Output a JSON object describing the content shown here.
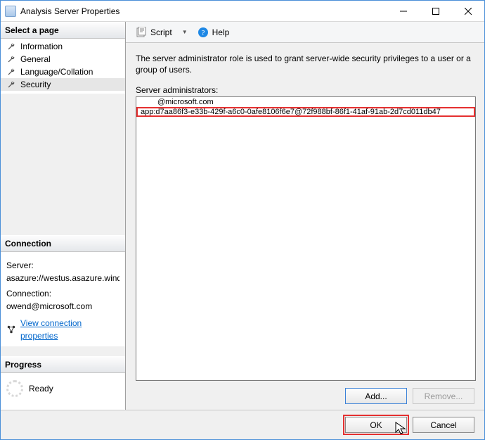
{
  "window": {
    "title": "Analysis Server Properties"
  },
  "left": {
    "select_head": "Select a page",
    "nav": [
      {
        "label": "Information"
      },
      {
        "label": "General"
      },
      {
        "label": "Language/Collation"
      },
      {
        "label": "Security"
      }
    ],
    "connection_head": "Connection",
    "server_label": "Server:",
    "server_value": "asazure://westus.asazure.windows",
    "conn_label": "Connection:",
    "conn_value": "owend@microsoft.com",
    "view_props": "View connection properties",
    "progress_head": "Progress",
    "progress_status": "Ready"
  },
  "toolbar": {
    "script": "Script",
    "help": "Help"
  },
  "main": {
    "intro": "The server administrator role is used to grant server-wide security privileges to a user or a group of users.",
    "list_label": "Server administrators:",
    "rows": [
      "@microsoft.com",
      "app:d7aa86f3-e33b-429f-a6c0-0afe8106f6e7@72f988bf-86f1-41af-91ab-2d7cd011db47"
    ],
    "add": "Add...",
    "remove": "Remove..."
  },
  "footer": {
    "ok": "OK",
    "cancel": "Cancel"
  }
}
